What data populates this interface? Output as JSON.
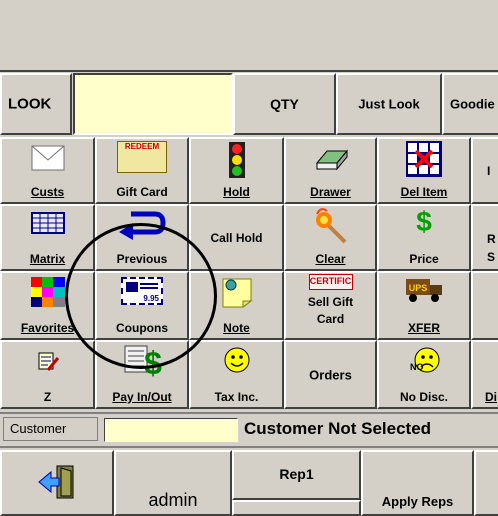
{
  "header": {
    "look_label": "LOOK",
    "qty_label": "QTY",
    "just_look_label": "Just Look",
    "goodies_label": "Goodie"
  },
  "grid": {
    "custs": "Custs",
    "gift_card": "Gift Card",
    "redeem_text": "REDEEM",
    "hold": "Hold",
    "drawer": "Drawer",
    "del_item": "Del Item",
    "matrix": "Matrix",
    "previous": "Previous",
    "call_hold": "Call Hold",
    "clear": "Clear",
    "price": "Price",
    "favorites": "Favorites",
    "coupons": "Coupons",
    "note": "Note",
    "certific_text": "CERTIFIC",
    "sell_gift_card_line1": "Sell Gift",
    "sell_gift_card_line2": "Card",
    "ups_text": "UPS",
    "xfer": "XFER",
    "z": "Z",
    "pay_in_out": "Pay In/Out",
    "tax_inc": "Tax Inc.",
    "orders": "Orders",
    "no_disc": "No Disc.",
    "coupon_price": "9.95",
    "no_text": "NO",
    "right_row1": "I",
    "right_row2_line1": "R",
    "right_row2_line2": "S",
    "right_row4": "Di"
  },
  "status": {
    "customer_label": "Customer",
    "customer_value": "Customer Not Selected"
  },
  "bottom": {
    "user": "admin",
    "rep": "Rep1",
    "apply_reps": "Apply Reps"
  },
  "colors": {
    "face": "#d4d0c8",
    "field": "#ffffcc"
  }
}
